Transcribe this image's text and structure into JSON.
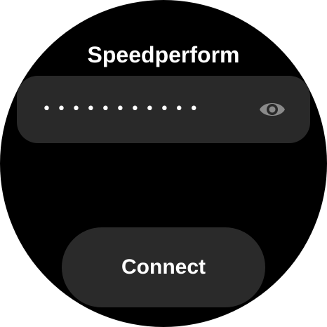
{
  "network": {
    "name": "Speedperform"
  },
  "password": {
    "masked_value": "•••••••••••",
    "toggle_icon": "eye-icon"
  },
  "actions": {
    "connect_label": "Connect"
  },
  "colors": {
    "background": "#000000",
    "field_background": "#292929",
    "button_background": "#2a2a2a",
    "text": "#ffffff",
    "icon": "#8a8a8a"
  }
}
